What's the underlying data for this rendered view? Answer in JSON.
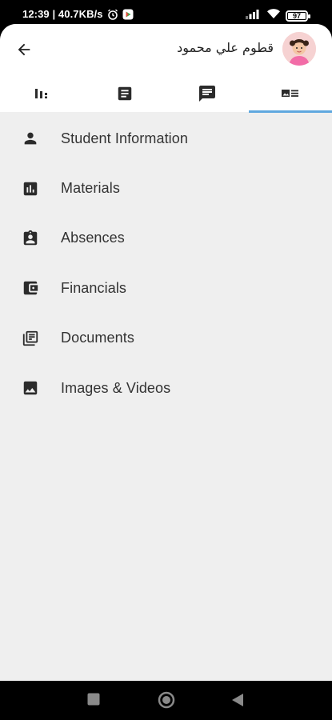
{
  "status_bar": {
    "time": "12:39",
    "separator": " | ",
    "network_speed": "40.7KB/s",
    "battery_level": "97",
    "icons": [
      "alarm-icon",
      "play-store-icon",
      "signal-icon",
      "wifi-icon",
      "battery-icon"
    ]
  },
  "header": {
    "back_icon": "arrow-left-icon",
    "user_name": "قطوم علي محمود",
    "avatar_icon": "child-avatar"
  },
  "tabs": [
    {
      "icon": "bar-chart-icon",
      "active": false
    },
    {
      "icon": "document-icon",
      "active": false
    },
    {
      "icon": "message-icon",
      "active": false
    },
    {
      "icon": "card-list-icon",
      "active": true
    }
  ],
  "menu": [
    {
      "label": "Student Information",
      "icon": "person-icon"
    },
    {
      "label": "Materials",
      "icon": "chart-box-icon"
    },
    {
      "label": "Absences",
      "icon": "assignment-ind-icon"
    },
    {
      "label": "Financials",
      "icon": "wallet-icon"
    },
    {
      "label": "Documents",
      "icon": "library-books-icon"
    },
    {
      "label": "Images & Videos",
      "icon": "image-icon"
    }
  ],
  "nav_bar": [
    "square-recents-icon",
    "circle-home-icon",
    "triangle-back-icon"
  ],
  "colors": {
    "accent": "#5fa8df",
    "background": "#efefef",
    "icon": "#2b2b2b"
  }
}
